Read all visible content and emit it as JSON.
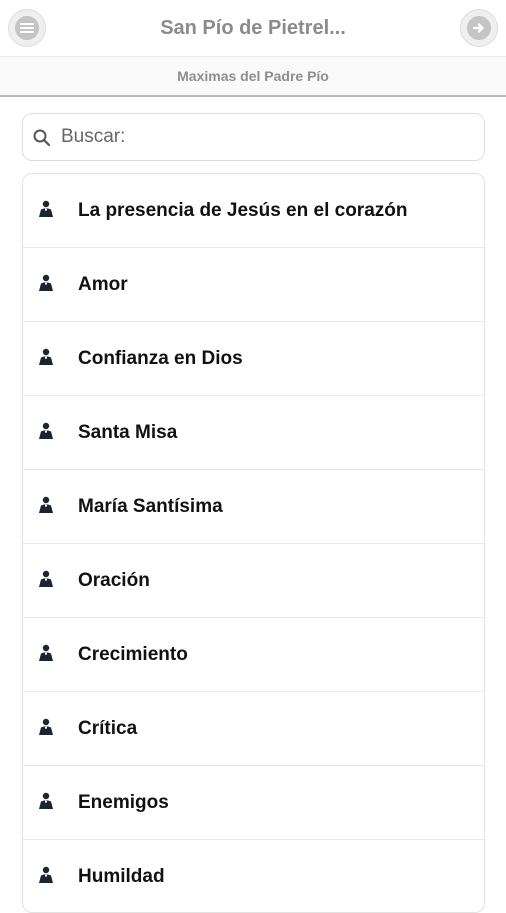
{
  "header": {
    "title": "San Pío de Pietrel...",
    "left_icon": "menu-circle-icon",
    "right_icon": "forward-circle-icon"
  },
  "subheader": {
    "title": "Maximas del Padre Pío"
  },
  "search": {
    "placeholder": "Buscar:",
    "value": ""
  },
  "list": {
    "item_icon": "priest-icon",
    "items": [
      {
        "label": "La presencia de Jesús en el corazón"
      },
      {
        "label": "Amor"
      },
      {
        "label": "Confianza en Dios"
      },
      {
        "label": "Santa Misa"
      },
      {
        "label": "María Santísima"
      },
      {
        "label": "Oración"
      },
      {
        "label": "Crecimiento"
      },
      {
        "label": "Crítica"
      },
      {
        "label": "Enemigos"
      },
      {
        "label": "Humildad"
      }
    ]
  },
  "colors": {
    "title_text": "#8b8b8b",
    "subheader_text": "#8e8e8e",
    "item_text": "#111111",
    "icon_dark": "#1c2430",
    "border": "#e2e2e2"
  }
}
